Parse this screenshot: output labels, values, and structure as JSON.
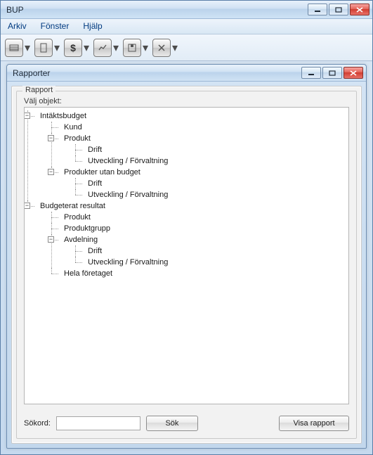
{
  "app": {
    "title": "BUP"
  },
  "menu": {
    "arkiv": "Arkiv",
    "fonster": "Fönster",
    "hjalp": "Hjälp"
  },
  "toolbar": {
    "icons": [
      "grid",
      "doc",
      "dollar",
      "chart",
      "disk",
      "tools"
    ]
  },
  "inner": {
    "title": "Rapporter",
    "group_label": "Rapport",
    "select_label": "Välj objekt:",
    "search_label": "Sökord:",
    "search_value": "",
    "search_btn": "Sök",
    "show_report_btn": "Visa rapport"
  },
  "tree": {
    "intaktsbudget": {
      "label": "Intäktsbudget",
      "kund": "Kund",
      "produkt": {
        "label": "Produkt",
        "drift": "Drift",
        "utv": "Utveckling / Förvaltning"
      },
      "produkter_utan_budget": {
        "label": "Produkter utan budget",
        "drift": "Drift",
        "utv": "Utveckling / Förvaltning"
      }
    },
    "budgeterat_resultat": {
      "label": "Budgeterat resultat",
      "produkt": "Produkt",
      "produktgrupp": "Produktgrupp",
      "avdelning": {
        "label": "Avdelning",
        "drift": "Drift",
        "utv": "Utveckling / Förvaltning"
      },
      "hela": "Hela företaget"
    }
  }
}
